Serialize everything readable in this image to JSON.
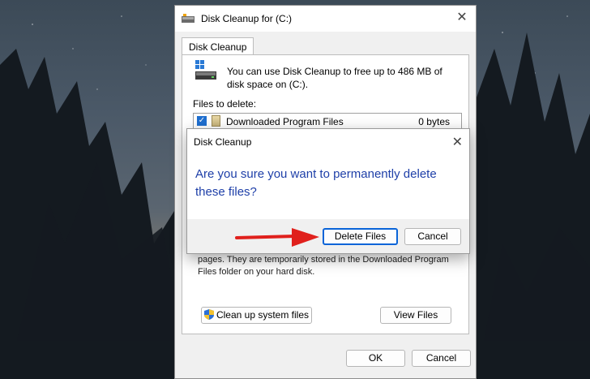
{
  "main_window": {
    "title": "Disk Cleanup for  (C:)",
    "close_glyph": "✕",
    "tab_label": "Disk Cleanup",
    "info_text": "You can use Disk Cleanup to free up to 486 MB of disk space on  (C:).",
    "files_to_delete_label": "Files to delete:",
    "files": [
      {
        "name": "Downloaded Program Files",
        "size": "0 bytes",
        "checked": true
      },
      {
        "name": "",
        "size": "",
        "checked": false
      }
    ],
    "description_partial": "pages. They are temporarily stored in the Downloaded Program Files folder on your hard disk.",
    "cleanup_system_label": "Clean up system files",
    "view_files_label": "View Files",
    "ok_label": "OK",
    "cancel_label": "Cancel"
  },
  "confirm_dialog": {
    "title": "Disk Cleanup",
    "close_glyph": "✕",
    "question": "Are you sure you want to permanently delete these files?",
    "delete_label": "Delete Files",
    "cancel_label": "Cancel"
  },
  "colors": {
    "accent_blue": "#0a64d8",
    "question_text": "#1e3fa8",
    "annotation_arrow": "#e0201c"
  },
  "icons": [
    "drive-icon",
    "close-icon",
    "checkbox-icon",
    "file-icon",
    "shield-icon",
    "arrow-annotation-icon"
  ]
}
